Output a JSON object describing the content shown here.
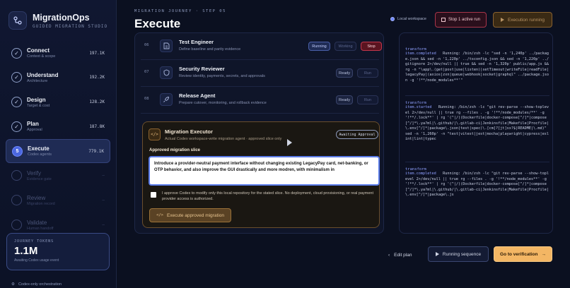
{
  "brand": {
    "name": "MigrationOps",
    "subtitle": "GUIDED MIGRATION STUDIO"
  },
  "sidebar": {
    "items": [
      {
        "title": "Connect",
        "sub": "Context & scope",
        "count": "197.1K",
        "state": "done"
      },
      {
        "title": "Understand",
        "sub": "Architecture",
        "count": "192.2K",
        "state": "done"
      },
      {
        "title": "Design",
        "sub": "Target & cost",
        "count": "128.2K",
        "state": "done"
      },
      {
        "title": "Plan",
        "sub": "Approval",
        "count": "187.8K",
        "state": "done"
      },
      {
        "title": "Execute",
        "sub": "Codex agents",
        "count": "779.1K",
        "state": "current",
        "step": "5"
      },
      {
        "title": "Verify",
        "sub": "Evidence gate",
        "count": "—",
        "state": "future"
      },
      {
        "title": "Review",
        "sub": "Migration record",
        "count": "—",
        "state": "future"
      },
      {
        "title": "Validate",
        "sub": "Human handoff",
        "count": "—",
        "state": "future"
      }
    ]
  },
  "tokens": {
    "label": "JOURNEY TOKENS",
    "value": "1.1M",
    "sub": "Awaiting Codex usage event"
  },
  "footer": {
    "label": "Codex-only orchestration"
  },
  "header": {
    "crumb": "MIGRATION JOURNEY · STEP 05",
    "title": "Execute",
    "workspace": "Local workspace",
    "stop_run": "Stop 1 active run",
    "exec_running": "Execution running"
  },
  "agents": [
    {
      "num": "06",
      "name": "Test Engineer",
      "desc": "Define baseline and parity evidence",
      "status": "Running",
      "secondary": "Working",
      "action": "Stop"
    },
    {
      "num": "07",
      "name": "Security Reviewer",
      "desc": "Review identity, payments, secrets, and approvals",
      "status": "Ready",
      "action": "Run"
    },
    {
      "num": "08",
      "name": "Release Agent",
      "desc": "Prepare cutover, monitoring, and rollback evidence",
      "status": "Ready",
      "action": "Run"
    }
  ],
  "executor": {
    "icon": "</>",
    "title": "Migration Executor",
    "subtitle": "Actual Codex workspace-write migration agent · approved slice only",
    "badge": "Awaiting Approval",
    "slice_label": "Approved migration slice",
    "slice_value": "Introduce a provider-neutral payment interface without changing existing LegacyPay card, net-banking, or OTP behavior, and also improve the GUI drastically and more modren, with minimalism in",
    "consent": "I approve Codex to modify only this local repository for the stated slice. No deployment, cloud provisioning, or real payment provider access is authorized.",
    "button": "Execute approved migration"
  },
  "log": [
    {
      "kind": "transform",
      "event": "item.completed",
      "text": "Running: /bin/zsh -lc \"sed -n '1,240p' ../package.json && sed -n '1,220p' ../tsconfig.json && sed -n '1,220p' ../gitignore 2>/dev/null || true && sed -n '1,320p' public/app.js && rg -n \"\\app\\.(get|post|use|listen)|setTimeout|writeFile|readFile|legacyPay|(axios|zxn|queue|webhook|socket|graphql\" ../package.json -g '!**/node_modules**'\""
    },
    {
      "kind": "transform",
      "event": "item.started",
      "text": "Running: /bin/zsh -lc \"git rev-parse --show-toplevel 2>/dev/null || true rg --files . -g '!**/node_modules/**' -g '!**/.lock**' | rg '(^|/)(Dockerfile|docker-compose[^/]*|compose[^/]*\\.ya?ml|\\.github/|\\.gitlab-ci|Jenkinsfile|Makefile|Procfile|\\.env[^/]*|package\\.json|test|spec)\\.[cm]?[jt]sx?$|README|\\.md)\" sed -n '1,260p' -n \"test|vitest|jest|mocha|playwright|cypress|eslint|lint|typec"
    },
    {
      "kind": "transform",
      "event": "item.completed",
      "text": "Running: /bin/zsh -lc \"git rev-parse --show-toplevel 2>/dev/null || true rg --files . -g '!**/node_modules**' -g '!**/.lock**' | rg '(^|/)(Dockerfile|docker-compose[^/]*|compose[^/]*\\.ya?ml|\\.github/|\\.gitlab-ci|Jenkinsfile|Makefile|Procfile|\\.env[^/]*|package\\.js"
    }
  ],
  "footer_actions": {
    "edit_plan": "Edit plan",
    "running_sequence": "Running sequence",
    "go_verification": "Go to verification"
  },
  "colors": {
    "accent": "#6e88ff",
    "warning": "#f3b664",
    "danger": "#c2364c",
    "background": "#0b1020"
  }
}
